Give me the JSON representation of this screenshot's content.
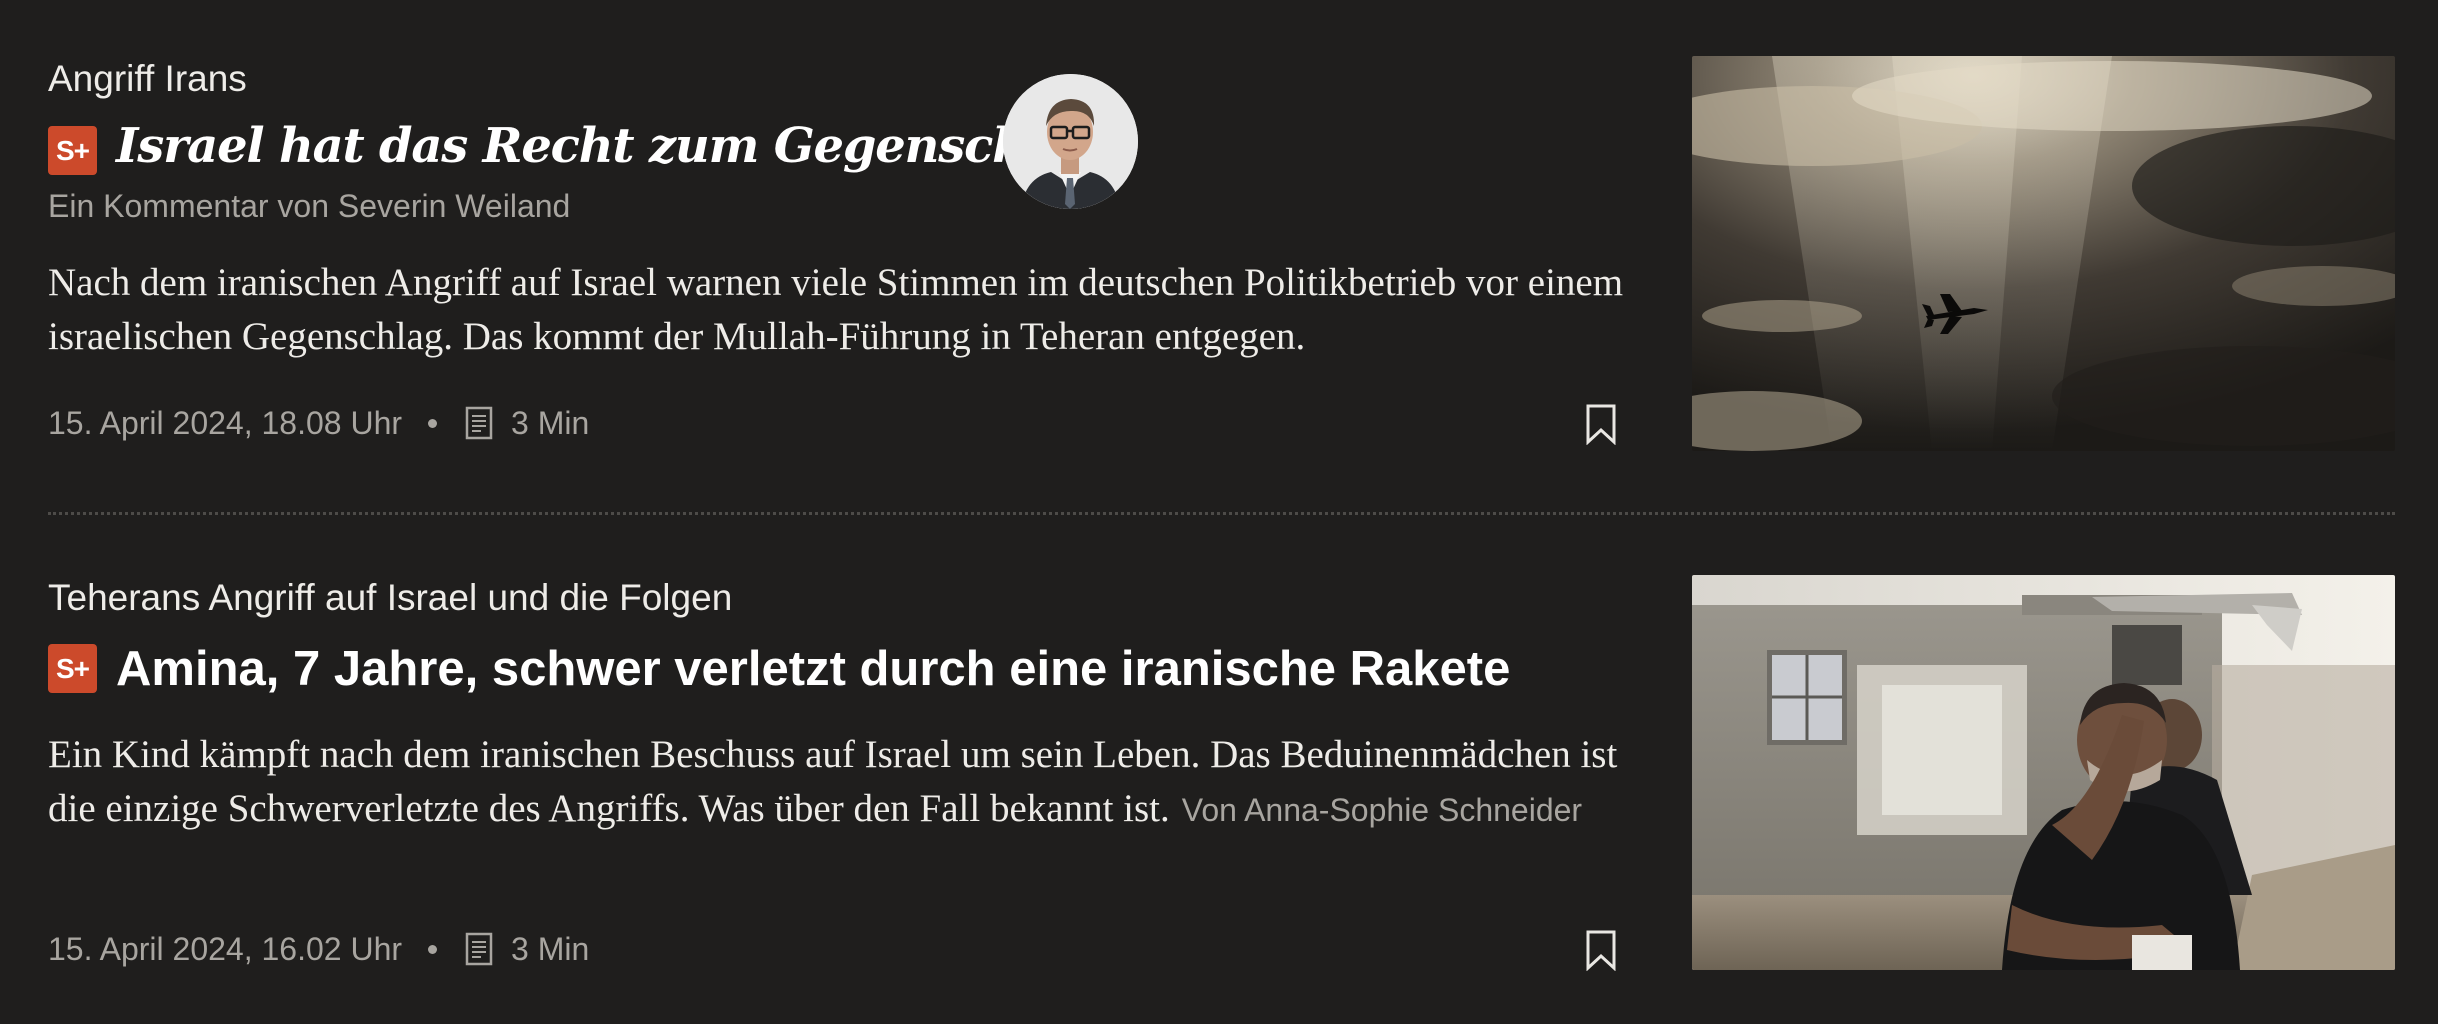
{
  "articles": [
    {
      "kicker": "Angriff Irans",
      "badge": "S+",
      "title": "Israel hat das Recht zum Gegenschlag",
      "byline": "Ein Kommentar von Severin Weiland",
      "teaser": "Nach dem iranischen Angriff auf Israel warnen viele Stimmen im deutschen Politikbetrieb vor einem israelischen Gegenschlag. Das kommt der Mullah-Führung in Teheran entgegen.",
      "date": "15. April 2024, 18.08 Uhr",
      "reading_time": "3 Min",
      "icons": [
        "document-icon",
        "bookmark-icon",
        "author-avatar",
        "fighter-jet-photo"
      ]
    },
    {
      "kicker": "Teherans Angriff auf Israel und die Folgen",
      "badge": "S+",
      "title": "Amina, 7 Jahre, schwer verletzt durch eine iranische Rakete",
      "teaser": "Ein Kind kämpft nach dem iranischen Beschuss auf Israel um sein Leben. Das Beduinenmädchen ist die einzige Schwerverletzte des Angriffs. Was über den Fall bekannt ist.",
      "byline": "Von Anna-Sophie Schneider",
      "date": "15. April 2024, 16.02 Uhr",
      "reading_time": "3 Min",
      "icons": [
        "document-icon",
        "bookmark-icon",
        "damaged-house-photo"
      ]
    }
  ],
  "colors": {
    "background": "#1f1e1d",
    "badge": "#cc4a2b",
    "text_primary": "#ffffff",
    "text_secondary": "#a8a5a0"
  }
}
